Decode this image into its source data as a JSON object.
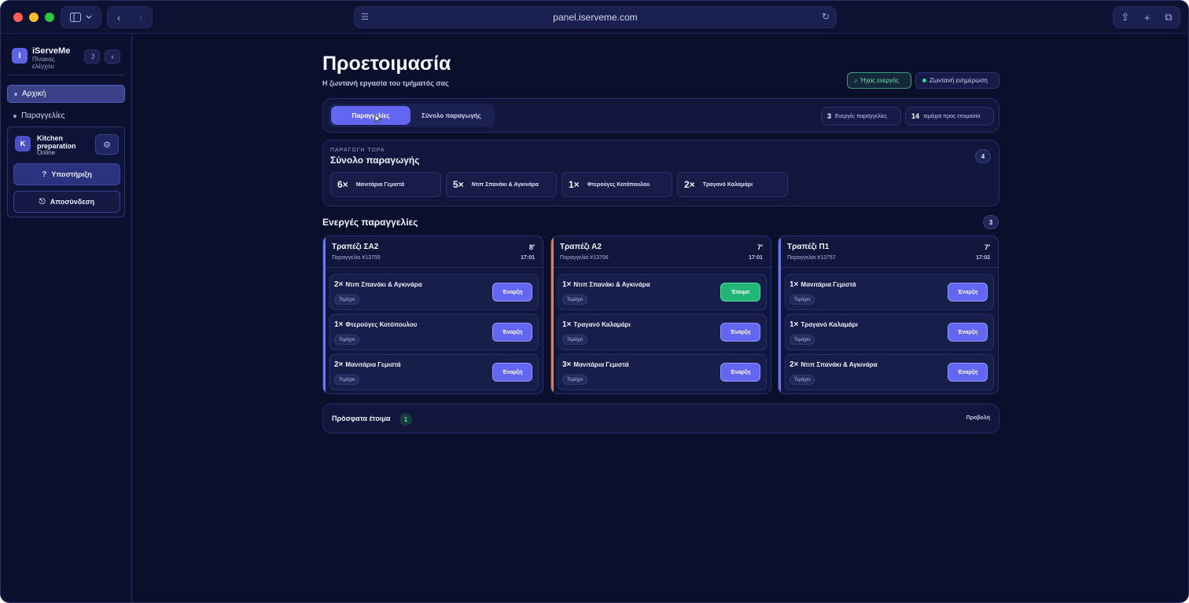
{
  "browser": {
    "url": "panel.iserveme.com",
    "nav_back": "‹",
    "nav_forward": "›",
    "share_icon": "⇪",
    "new_tab_icon": "+",
    "tabs_icon": "⧉",
    "reload_icon": "↻",
    "page_icon": "☰"
  },
  "sidebar": {
    "brand_letter": "I",
    "brand_name": "iServeMe",
    "brand_sub": "Πίνακας ελέγχου",
    "theme_icon": "☽",
    "collapse_icon": "‹",
    "nav": [
      {
        "label": "Αρχική",
        "active": true
      },
      {
        "label": "Παραγγελίες",
        "active": false
      }
    ],
    "kitchen": {
      "avatar": "K",
      "name": "Kitchen preparation",
      "status": "Online",
      "settings_icon": "⚙",
      "support_label": "Υποστήριξη",
      "support_icon": "?",
      "logout_label": "Αποσύνδεση",
      "logout_icon": "⎋"
    }
  },
  "header": {
    "title": "Προετοιμασία",
    "subtitle": "Η ζωντανή εργασία του τμήματός σας",
    "sound_label": "Ήχος ενεργός",
    "sound_icon": "♪",
    "live_label": "Ζωντανή ενημέρωση"
  },
  "tabs": {
    "orders": "Παραγγελίες",
    "total": "Σύνολο παραγωγής",
    "active_count": "3",
    "active_label": "Ενεργές παραγγελίες",
    "items_count": "14",
    "items_label": "τεμάχια προς ετοιμασία"
  },
  "production": {
    "overline": "ΠΑΡΑΓΩΓΗ ΤΩΡΑ",
    "title": "Σύνολο παραγωγής",
    "count": "4",
    "items": [
      {
        "qty": "6×",
        "name": "Μανιτάρια Γεμιστά"
      },
      {
        "qty": "5×",
        "name": "Ντιπ Σπανάκι & Αγκινάρα"
      },
      {
        "qty": "1×",
        "name": "Φτερούγες Κοτόπουλου"
      },
      {
        "qty": "2×",
        "name": "Τραγανό Καλαμάρι"
      }
    ]
  },
  "active_orders": {
    "title": "Ενεργές παραγγελίες",
    "count": "3",
    "tag_label": "Τεμάχιο",
    "orders": [
      {
        "table": "Τραπέζι ΣΑ2",
        "order_no": "Παραγγελία #13755",
        "minutes": "8′",
        "time": "17:01",
        "accent": "#6f74f5",
        "items": [
          {
            "qty": "2×",
            "name": "Ντιπ Σπανάκι & Αγκινάρα",
            "action": "Έναρξη",
            "state": "start"
          },
          {
            "qty": "1×",
            "name": "Φτερούγες Κοτόπουλου",
            "action": "Έναρξη",
            "state": "start"
          },
          {
            "qty": "2×",
            "name": "Μανιτάρια Γεμιστά",
            "action": "Έναρξη",
            "state": "start"
          }
        ]
      },
      {
        "table": "Τραπέζι Α2",
        "order_no": "Παραγγελία #13756",
        "minutes": "7′",
        "time": "17:01",
        "accent": "#e0834a",
        "items": [
          {
            "qty": "1×",
            "name": "Ντιπ Σπανάκι & Αγκινάρα",
            "action": "Έτοιμο",
            "state": "ready"
          },
          {
            "qty": "1×",
            "name": "Τραγανό Καλαμάρι",
            "action": "Έναρξη",
            "state": "start"
          },
          {
            "qty": "3×",
            "name": "Μανιτάρια Γεμιστά",
            "action": "Έναρξη",
            "state": "start"
          }
        ]
      },
      {
        "table": "Τραπέζι Π1",
        "order_no": "Παραγγελία #13757",
        "minutes": "7′",
        "time": "17:02",
        "accent": "#6f74f5",
        "items": [
          {
            "qty": "1×",
            "name": "Μανιτάρια Γεμιστά",
            "action": "Έναρξη",
            "state": "start"
          },
          {
            "qty": "1×",
            "name": "Τραγανό Καλαμάρι",
            "action": "Έναρξη",
            "state": "start"
          },
          {
            "qty": "2×",
            "name": "Ντιπ Σπανάκι & Αγκινάρα",
            "action": "Έναρξη",
            "state": "start"
          }
        ]
      }
    ]
  },
  "recent": {
    "title": "Πρόσφατα έτοιμα",
    "count": "1",
    "view_label": "Προβολή"
  }
}
